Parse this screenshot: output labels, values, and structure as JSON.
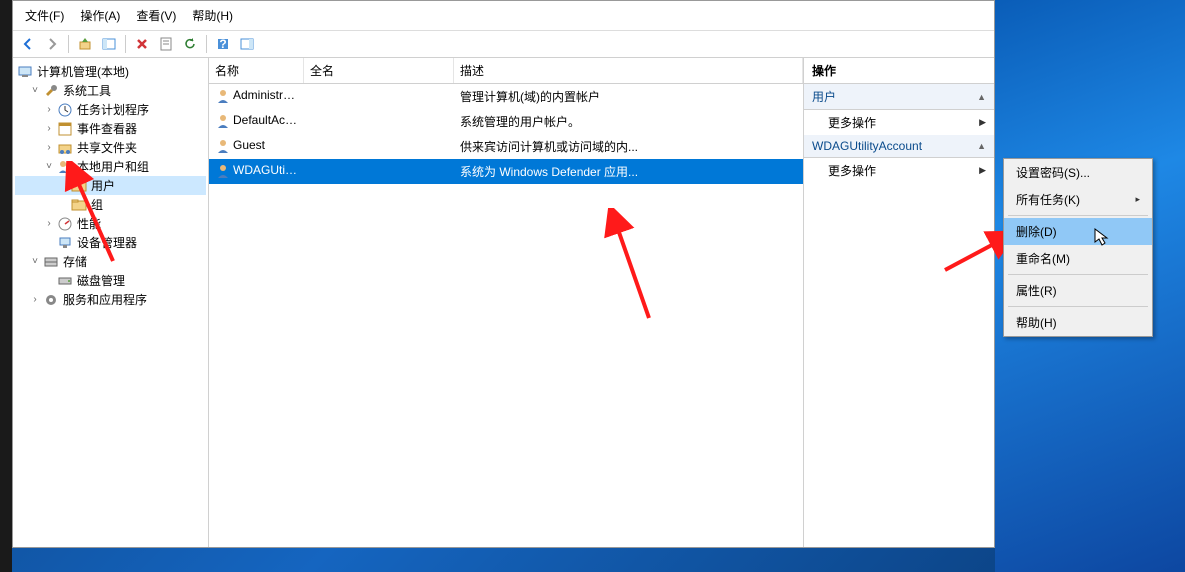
{
  "menubar": {
    "file": "文件(F)",
    "action": "操作(A)",
    "view": "查看(V)",
    "help": "帮助(H)"
  },
  "tree": {
    "root": "计算机管理(本地)",
    "systools": "系统工具",
    "taskScheduler": "任务计划程序",
    "eventViewer": "事件查看器",
    "sharedFolders": "共享文件夹",
    "localUsers": "本地用户和组",
    "users": "用户",
    "groups": "组",
    "performance": "性能",
    "deviceMgr": "设备管理器",
    "storage": "存储",
    "diskMgmt": "磁盘管理",
    "servicesApps": "服务和应用程序"
  },
  "listHeader": {
    "name": "名称",
    "fullName": "全名",
    "desc": "描述"
  },
  "users": [
    {
      "name": "Administrat...",
      "full": "",
      "desc": "管理计算机(域)的内置帐户",
      "selected": false
    },
    {
      "name": "DefaultAcc...",
      "full": "",
      "desc": "系统管理的用户帐户。",
      "selected": false
    },
    {
      "name": "Guest",
      "full": "",
      "desc": "供来宾访问计算机或访问域的内...",
      "selected": false
    },
    {
      "name": "WDAGUtilit...",
      "full": "",
      "desc": "系统为 Windows Defender 应用...",
      "selected": true
    }
  ],
  "actions": {
    "title": "操作",
    "section1": "用户",
    "moreActions": "更多操作",
    "section2": "WDAGUtilityAccount"
  },
  "context": {
    "setPassword": "设置密码(S)...",
    "allTasks": "所有任务(K)",
    "delete": "删除(D)",
    "rename": "重命名(M)",
    "properties": "属性(R)",
    "help": "帮助(H)"
  }
}
